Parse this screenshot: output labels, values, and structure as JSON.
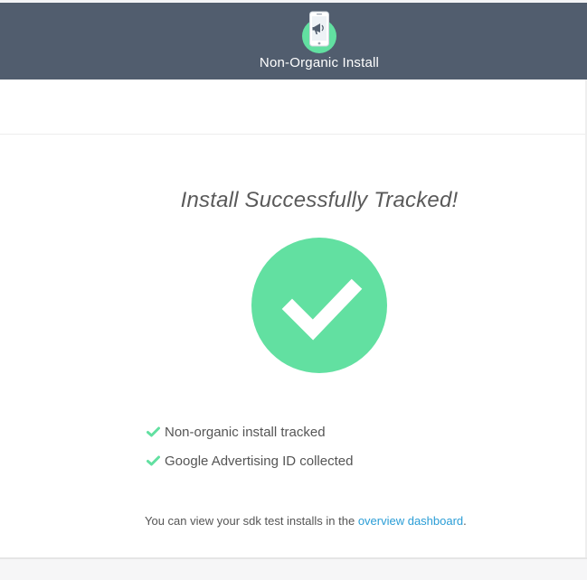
{
  "header": {
    "icon": "phone-megaphone-icon",
    "title": "Non-Organic Install"
  },
  "main": {
    "title": "Install Successfully Tracked!",
    "success_icon": "checkmark-icon",
    "checklist": [
      {
        "icon": "check-icon",
        "label": "Non-organic install tracked"
      },
      {
        "icon": "check-icon",
        "label": "Google Advertising ID collected"
      }
    ],
    "footer": {
      "prefix": "You can view your sdk test installs in the ",
      "link_label": "overview dashboard",
      "suffix": "."
    }
  },
  "colors": {
    "header_bg": "#515d6e",
    "success_green": "#62e0a1",
    "link_blue": "#2a9dd6"
  }
}
